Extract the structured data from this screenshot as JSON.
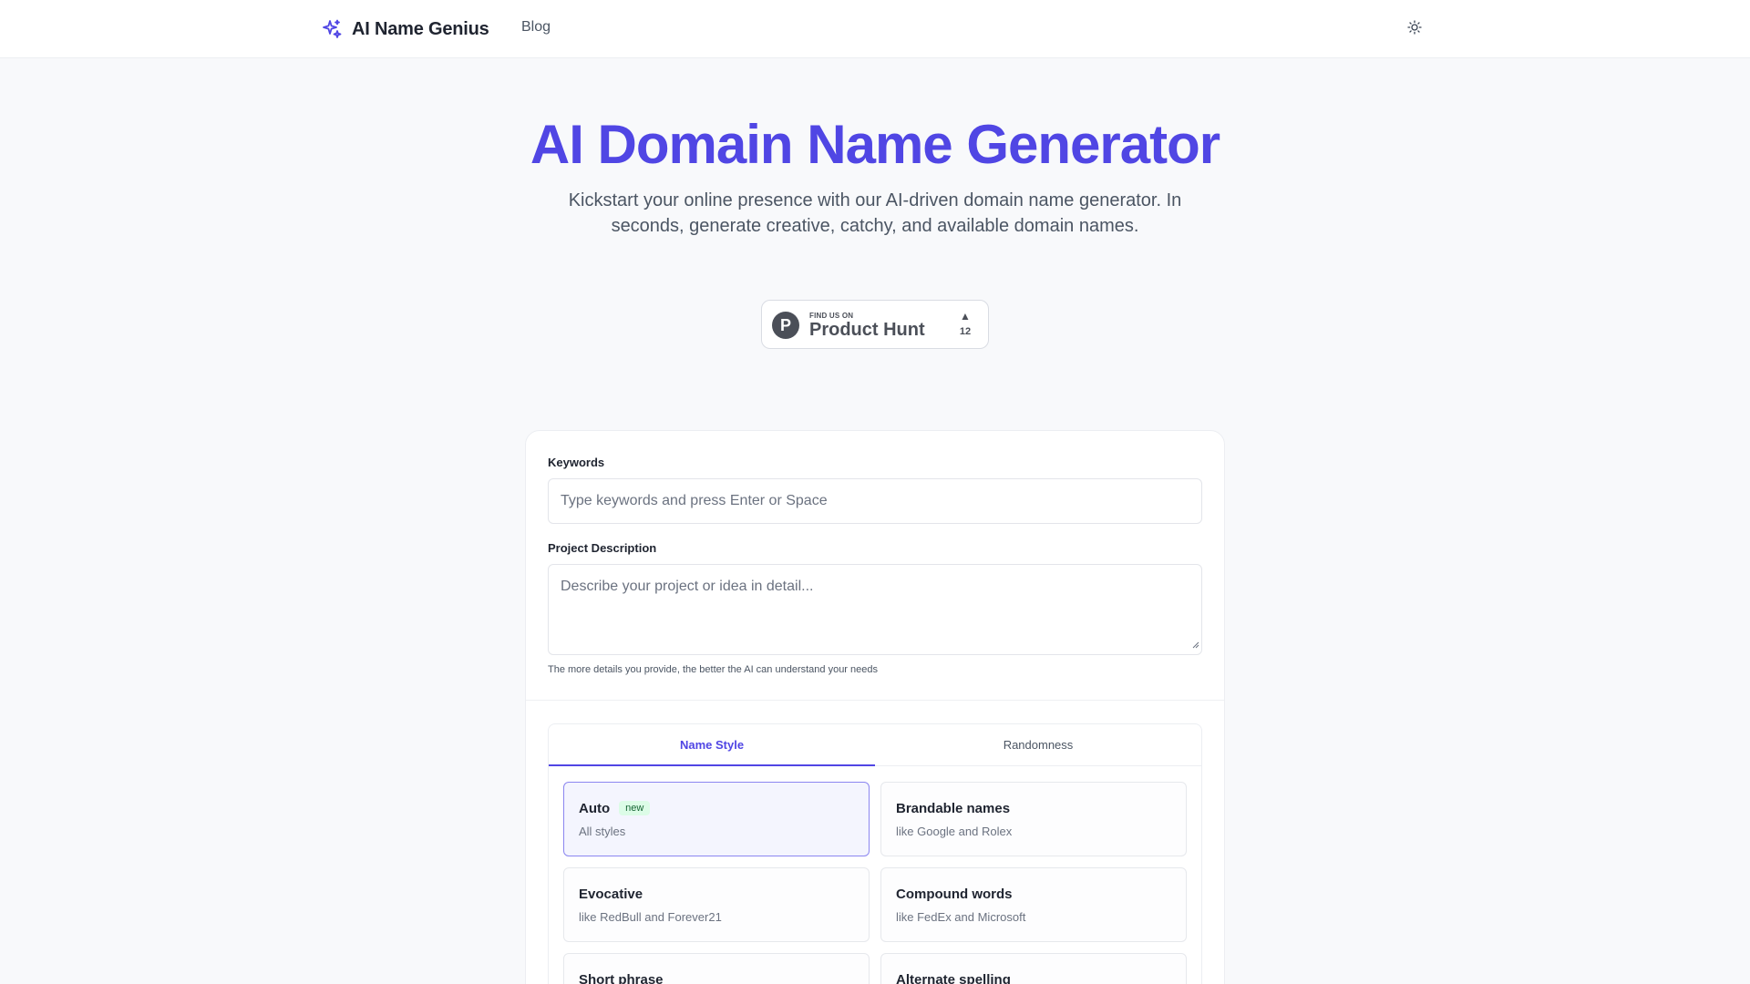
{
  "header": {
    "brand_name": "AI Name Genius",
    "nav_blog": "Blog",
    "theme_icon": "sun-icon"
  },
  "hero": {
    "title": "AI Domain Name Generator",
    "subtitle": "Kickstart your online presence with our AI-driven domain name generator. In seconds, generate creative, catchy, and available domain names."
  },
  "product_hunt": {
    "small_text": "FIND US ON",
    "big_text": "Product Hunt",
    "logo_letter": "P",
    "vote_count": "12"
  },
  "form": {
    "keywords_label": "Keywords",
    "keywords_placeholder": "Type keywords and press Enter or Space",
    "description_label": "Project Description",
    "description_placeholder": "Describe your project or idea in detail...",
    "hint": "The more details you provide, the better the AI can understand your needs"
  },
  "tabs": [
    {
      "label": "Name Style",
      "active": true
    },
    {
      "label": "Randomness",
      "active": false
    }
  ],
  "styles": [
    {
      "title": "Auto",
      "badge": "new",
      "desc": "All styles",
      "selected": true
    },
    {
      "title": "Brandable names",
      "desc": "like Google and Rolex",
      "selected": false
    },
    {
      "title": "Evocative",
      "desc": "like RedBull and Forever21",
      "selected": false
    },
    {
      "title": "Compound words",
      "desc": "like FedEx and Microsoft",
      "selected": false
    },
    {
      "title": "Short phrase",
      "desc": "",
      "selected": false
    },
    {
      "title": "Alternate spelling",
      "desc": "",
      "selected": false
    }
  ],
  "colors": {
    "accent": "#5046e4",
    "background": "#f8f9fb",
    "badge_green_bg": "#dcfce7"
  }
}
